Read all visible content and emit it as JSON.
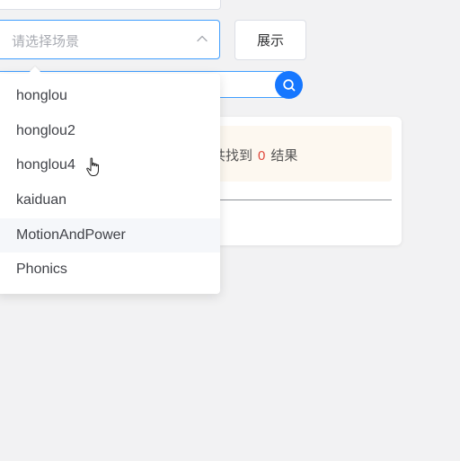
{
  "scene_select": {
    "placeholder": "请选择场景",
    "options": [
      {
        "label": "honglou"
      },
      {
        "label": "honglou2"
      },
      {
        "label": "honglou4"
      },
      {
        "label": "kaiduan"
      },
      {
        "label": "MotionAndPower"
      },
      {
        "label": "Phonics"
      }
    ],
    "hovered_index": 4
  },
  "show_button": {
    "label": "展示"
  },
  "search": {
    "value": ""
  },
  "results": {
    "prefix": "共找到",
    "count": "0",
    "suffix": "结果"
  },
  "colors": {
    "accent": "#409eff",
    "search_button": "#1677ff",
    "count_red": "#e0493c"
  },
  "icons": {
    "select_arrow": "chevron-up-icon",
    "search": "search-icon",
    "cursor": "hand-pointer-icon"
  }
}
